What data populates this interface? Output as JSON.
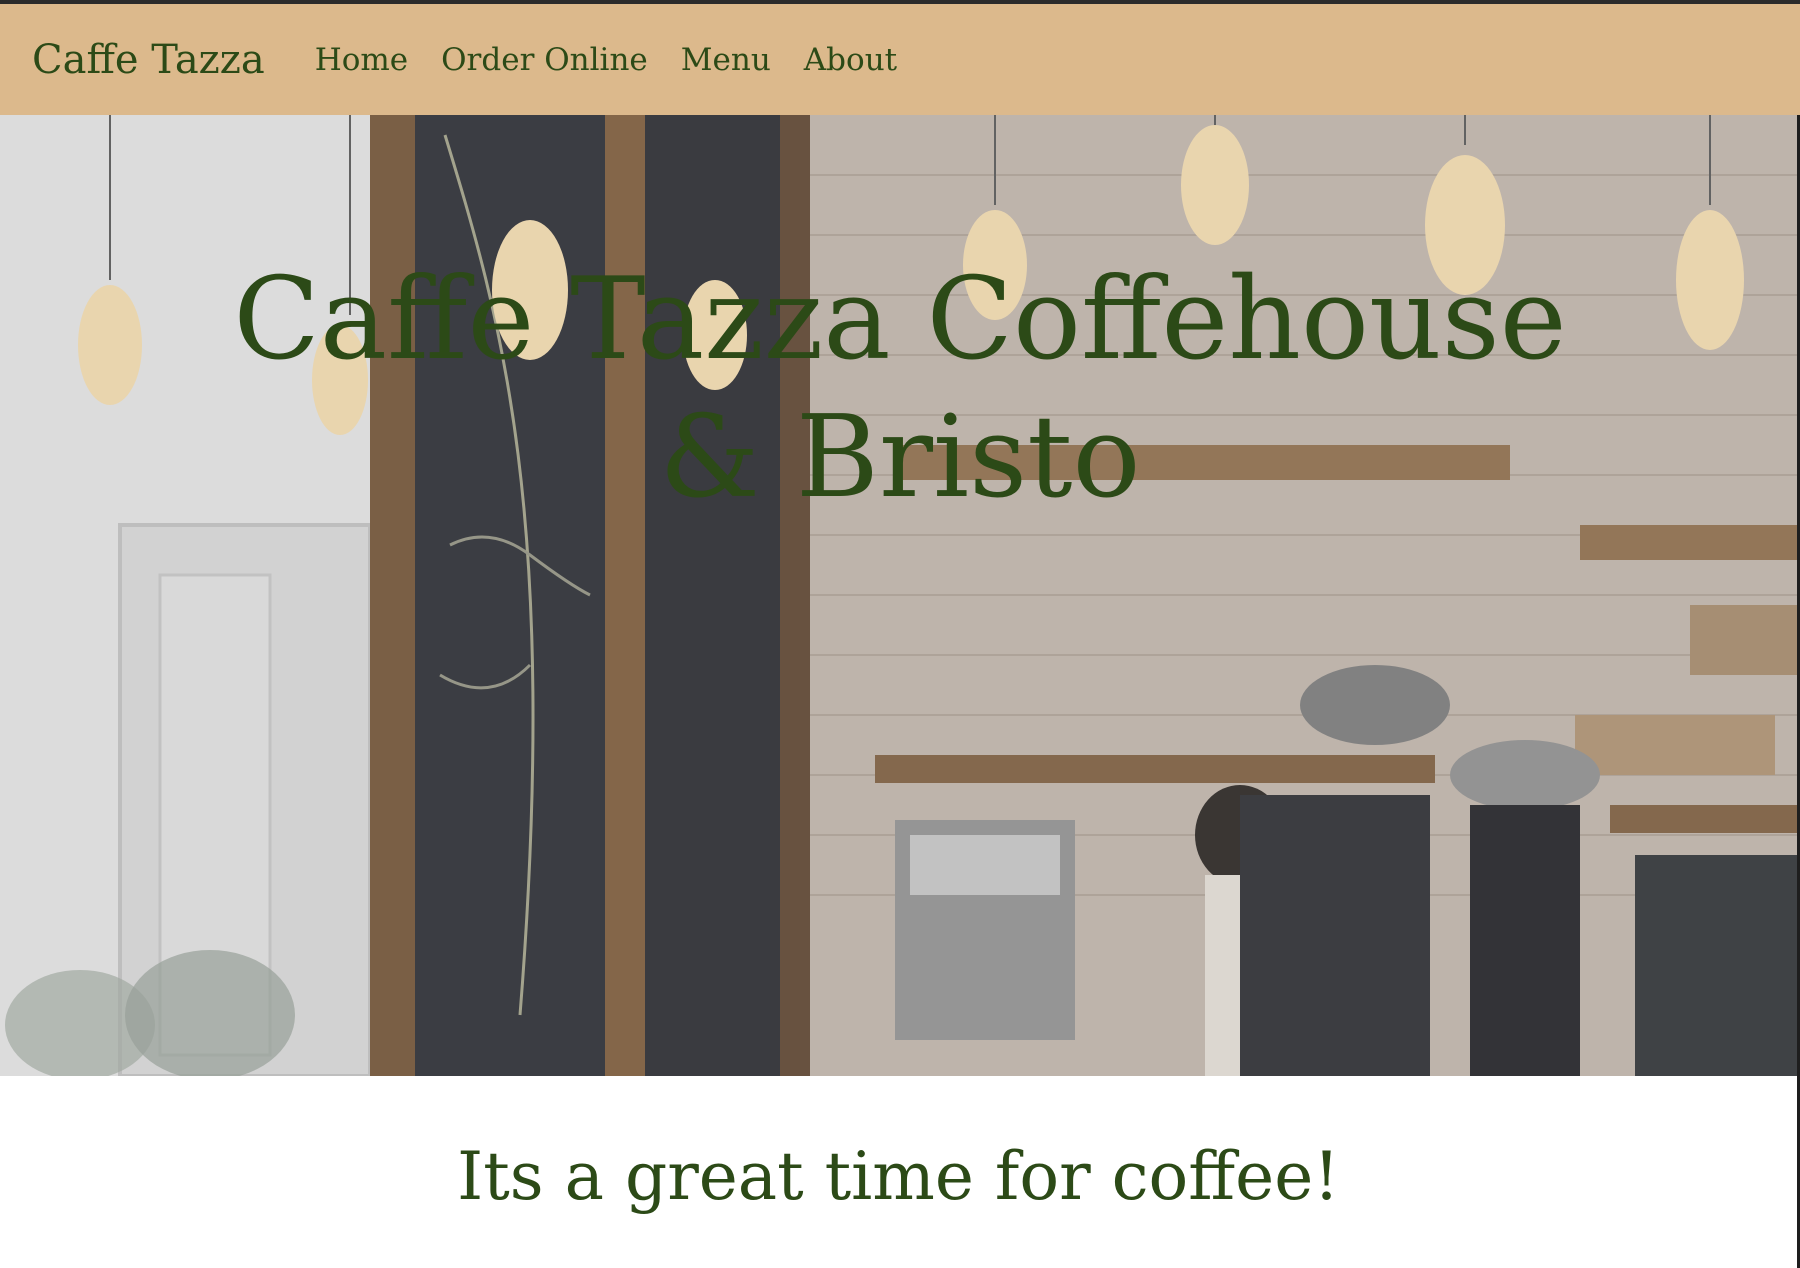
{
  "header": {
    "brand": "Caffe Tazza",
    "nav": [
      {
        "label": "Home"
      },
      {
        "label": "Order Online"
      },
      {
        "label": "Menu"
      },
      {
        "label": "About"
      }
    ]
  },
  "hero": {
    "title": "Caffe Tazza Coffehouse & Bristo",
    "image": "cafe-interior-photo"
  },
  "main": {
    "tagline": "Its a great time for coffee!"
  },
  "colors": {
    "nav_background": "#dcb98c",
    "text_green": "#2c4a17",
    "page_background": "#ffffff"
  }
}
